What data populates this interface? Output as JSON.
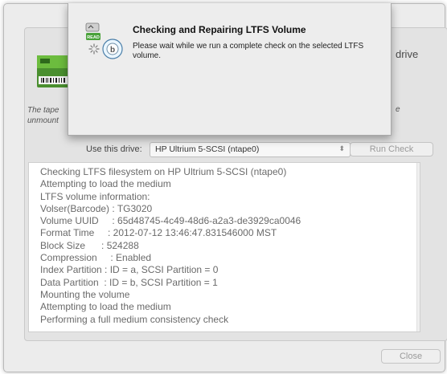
{
  "background": {
    "drive_fragment": "drive",
    "desc_line1": "The tape",
    "desc_line2": "unmount",
    "desc_right": "e"
  },
  "controls": {
    "use_drive_label": "Use this drive:",
    "drive_selected": "HP Ultrium 5-SCSI (ntape0)",
    "run_check_label": "Run Check",
    "close_label": "Close"
  },
  "log": {
    "lines": [
      "Checking LTFS filesystem on HP Ultrium 5-SCSI (ntape0)",
      "Attempting to load the medium",
      "LTFS volume information:",
      "Volser(Barcode) : TG3020",
      "Volume UUID     : 65d48745-4c49-48d6-a2a3-de3929ca0046",
      "Format Time     : 2012-07-12 13:46:47.831546000 MST",
      "Block Size      : 524288",
      "Compression     : Enabled",
      "Index Partition : ID = a, SCSI Partition = 0",
      "Data Partition  : ID = b, SCSI Partition = 1",
      "Mounting the volume",
      "Attempting to load the medium",
      "Performing a full medium consistency check"
    ]
  },
  "sheet": {
    "title": "Checking and Repairing LTFS Volume",
    "message": "Please wait while we run a complete check on the selected LTFS volume.",
    "icon_badge": "READ"
  },
  "colors": {
    "window_bg": "#ececec",
    "log_text": "#6a6a6a"
  }
}
